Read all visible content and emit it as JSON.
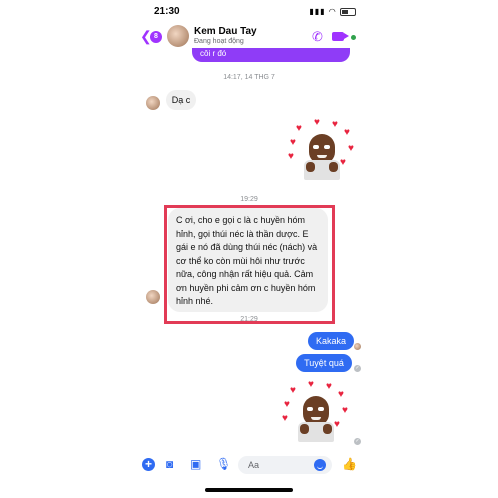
{
  "status_bar": {
    "time": "21:30"
  },
  "header": {
    "back_count": "8",
    "contact_name": "Kem Dau Tay",
    "status": "Đang hoạt động"
  },
  "messages": {
    "top_partial": "côi r đó",
    "ts1": "14:17, 14 THG 7",
    "reply1": "Dạ c",
    "ts2": "19:29",
    "long_message": "C ơi, cho e gọi c là c huyền hóm hỉnh, gọi thúi néc là thần dược. E gái e nó đã dùng thúi néc (nách) và cơ thể ko còn mùi hôi như trước nữa, công nhận rất hiệu quả. Cảm ơn huyền phi cảm ơn c huyền hóm hỉnh nhé.",
    "ts3": "21:29",
    "out1": "Kakaka",
    "out2": "Tuyệt quá"
  },
  "input_bar": {
    "placeholder": "Aa"
  },
  "colors": {
    "accent_purple": "#a033ff",
    "outgoing_blue": "#2f6bf2",
    "highlight_red": "#e23b56"
  },
  "icons": [
    "back-chevron-icon",
    "phone-icon",
    "video-icon",
    "plus-icon",
    "camera-icon",
    "image-icon",
    "microphone-icon",
    "emoji-icon",
    "like-icon"
  ]
}
